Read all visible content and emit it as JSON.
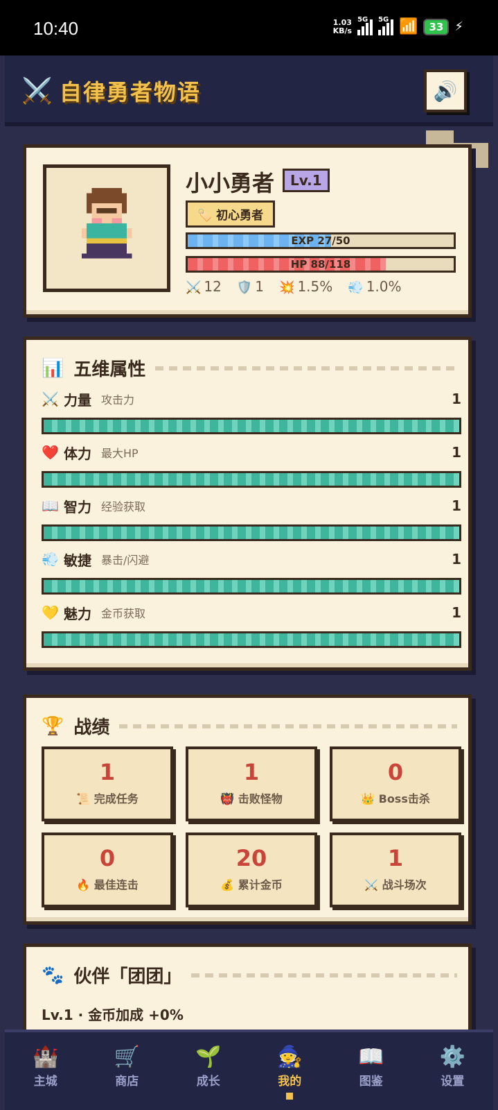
{
  "status_bar": {
    "time": "10:40",
    "net_speed": "1.03",
    "net_unit": "KB/s",
    "sim1": "5G",
    "sim2": "5G",
    "battery": "33"
  },
  "header": {
    "title": "自律勇者物语",
    "title_icon": "⚔️",
    "sound_icon": "🔊"
  },
  "profile": {
    "name": "小小勇者",
    "level": "Lv.1",
    "badge": "🏷️ 初心勇者",
    "exp_label": "EXP 27/50",
    "exp_fraction": 0.54,
    "hp_label": "HP 88/118",
    "hp_fraction": 0.746,
    "stats": [
      {
        "icon": "⚔️",
        "value": "12"
      },
      {
        "icon": "🛡️",
        "value": "1"
      },
      {
        "icon": "💥",
        "value": "1.5%"
      },
      {
        "icon": "💨",
        "value": "1.0%"
      }
    ]
  },
  "attributes": {
    "title": "五维属性",
    "icon": "📊",
    "items": [
      {
        "icon": "⚔️",
        "name": "力量",
        "desc": "攻击力",
        "value": "1"
      },
      {
        "icon": "❤️",
        "name": "体力",
        "desc": "最大HP",
        "value": "1"
      },
      {
        "icon": "📖",
        "name": "智力",
        "desc": "经验获取",
        "value": "1"
      },
      {
        "icon": "💨",
        "name": "敏捷",
        "desc": "暴击/闪避",
        "value": "1"
      },
      {
        "icon": "💛",
        "name": "魅力",
        "desc": "金币获取",
        "value": "1"
      }
    ]
  },
  "records": {
    "title": "战绩",
    "icon": "🏆",
    "items": [
      {
        "value": "1",
        "label": "📜 完成任务"
      },
      {
        "value": "1",
        "label": "👹 击败怪物"
      },
      {
        "value": "0",
        "label": "👑 Boss击杀"
      },
      {
        "value": "0",
        "label": "🔥 最佳连击"
      },
      {
        "value": "20",
        "label": "💰 累计金币"
      },
      {
        "value": "1",
        "label": "⚔️ 战斗场次"
      }
    ]
  },
  "partner": {
    "title": "伙伴「团团」",
    "icon": "🐾",
    "subtitle": "Lv.1 · 金币加成 +0%"
  },
  "nav": [
    {
      "icon": "🏰",
      "label": "主城"
    },
    {
      "icon": "🛒",
      "label": "商店"
    },
    {
      "icon": "🌱",
      "label": "成长"
    },
    {
      "icon": "🧙",
      "label": "我的"
    },
    {
      "icon": "📖",
      "label": "图鉴"
    },
    {
      "icon": "⚙️",
      "label": "设置"
    }
  ],
  "active_nav": "我的",
  "colors": {
    "accent_gold": "#f2c14e",
    "panel": "#fbf2dd",
    "border": "#3a2a1e",
    "record_number": "#c9453a",
    "attr_bar": "#3fb59e"
  }
}
